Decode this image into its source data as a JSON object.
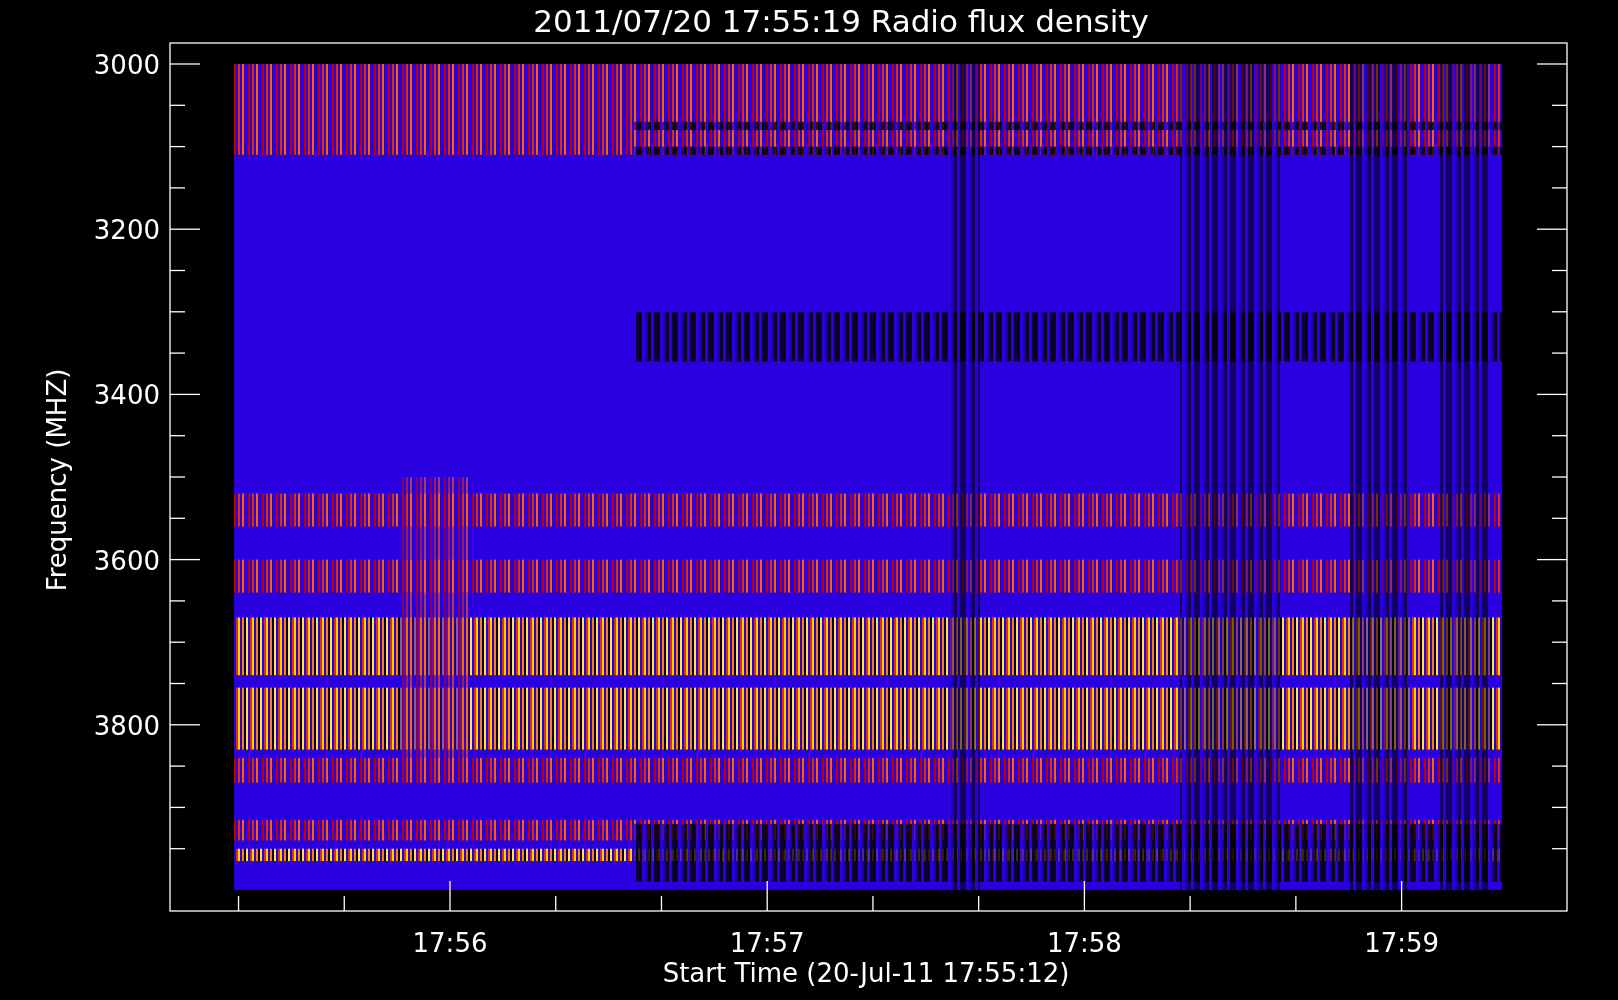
{
  "title": "2011/07/20 17:55:19 Radio flux density",
  "y_axis": {
    "label": "Frequency (MHZ)",
    "ticks": [
      "3000",
      "3200",
      "3400",
      "3600",
      "3800"
    ]
  },
  "x_axis": {
    "label": "Start Time (20-Jul-11 17:55:12)",
    "ticks": [
      "17:56",
      "17:57",
      "17:58",
      "17:59"
    ]
  }
}
